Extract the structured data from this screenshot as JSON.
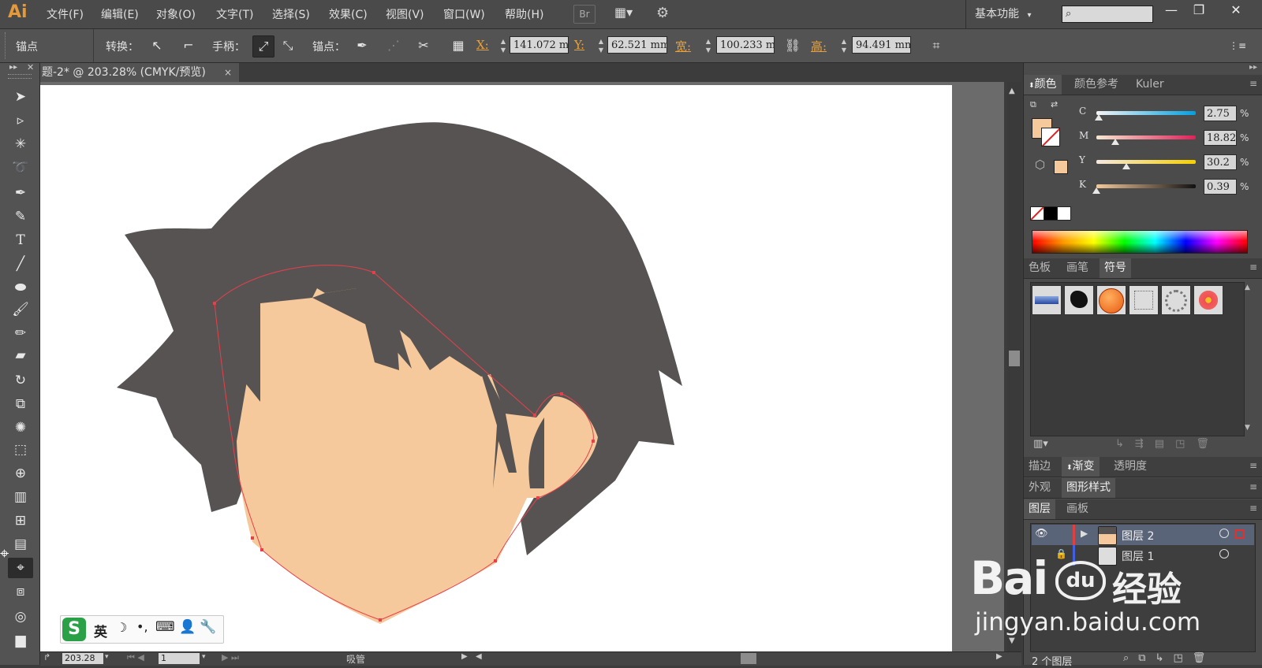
{
  "app": {
    "logo": "Ai"
  },
  "menu": [
    "文件(F)",
    "编辑(E)",
    "对象(O)",
    "文字(T)",
    "选择(S)",
    "效果(C)",
    "视图(V)",
    "窗口(W)",
    "帮助(H)"
  ],
  "bridge_label": "Br",
  "workspace": "基本功能",
  "search": {
    "value": ""
  },
  "window_controls": [
    "—",
    "❐",
    "✕"
  ],
  "control_bar": {
    "anchor_label": "锚点",
    "convert_label": "转换：",
    "handle_label": "手柄：",
    "anchor_points_label": "锚点：",
    "x_label": "X:",
    "x_value": "141.072 m",
    "y_label": "Y:",
    "y_value": "62.521 mm",
    "w_label": "宽:",
    "w_value": "100.233 m",
    "h_label": "高:",
    "h_value": "94.491 mm"
  },
  "document": {
    "tab_title": "题-2* @ 203.28% (CMYK/预览)",
    "close": "×"
  },
  "status_bar": {
    "zoom": "203.28",
    "artboard": "1",
    "current_tool": "吸管"
  },
  "color_panel": {
    "tabs": [
      "颜色",
      "颜色参考",
      "Kuler"
    ],
    "fill_color": "#f5c99b",
    "channels": [
      {
        "name": "C",
        "value": "2.75",
        "fraction": 0.0275
      },
      {
        "name": "M",
        "value": "18.82",
        "fraction": 0.1882
      },
      {
        "name": "Y",
        "value": "30.2",
        "fraction": 0.302
      },
      {
        "name": "K",
        "value": "0.39",
        "fraction": 0.0039
      }
    ],
    "percent": "%"
  },
  "swatch_panel": {
    "tabs": [
      "色板",
      "画笔",
      "符号"
    ],
    "symbols": [
      "blue-bar-symbol",
      "ink-splat-symbol",
      "orange-button-symbol",
      "dotted-frame-symbol",
      "ring-symbol",
      "flower-symbol"
    ]
  },
  "stroke_panel": {
    "tabs": [
      "描边",
      "渐变",
      "透明度"
    ]
  },
  "appearance_panel": {
    "tabs": [
      "外观",
      "图形样式"
    ]
  },
  "layers_panel": {
    "tabs": [
      "图层",
      "画板"
    ],
    "layers": [
      "图层 2",
      "图层 1"
    ],
    "count": "2 个图层"
  },
  "art": {
    "hair_color": "#585353",
    "skin_color": "#f5c99b",
    "path_color": "#e8404a"
  },
  "ime": {
    "lang": "英"
  },
  "watermark": {
    "brand": "Bai",
    "paw": "du",
    "cn": "经验",
    "url": "jingyan.baidu.com"
  }
}
